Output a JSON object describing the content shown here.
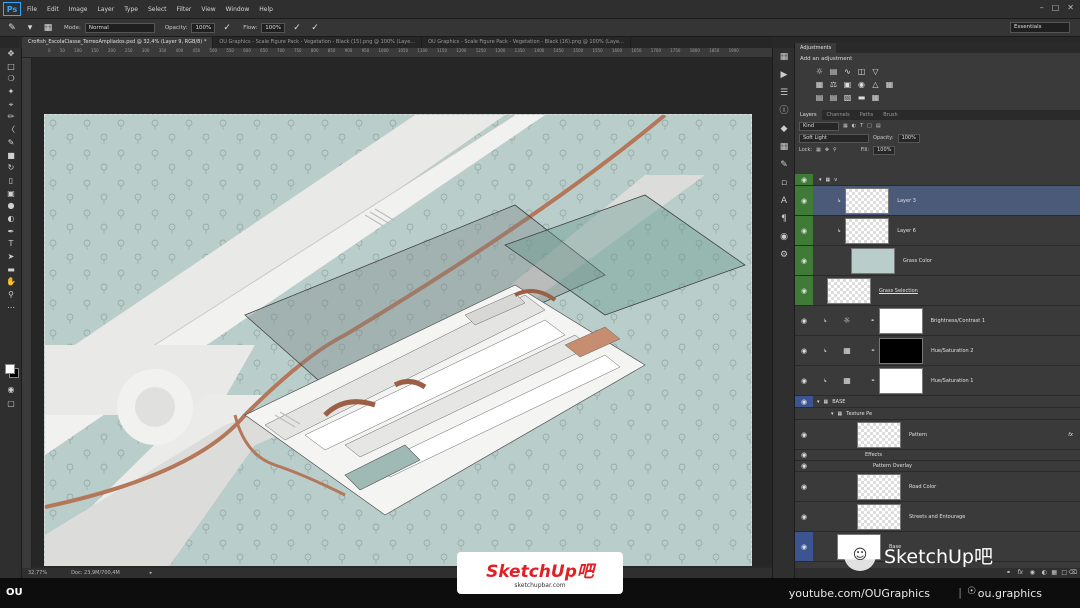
{
  "menubar": {
    "logo": "Ps",
    "items": [
      "File",
      "Edit",
      "Image",
      "Layer",
      "Type",
      "Select",
      "Filter",
      "View",
      "Window",
      "Help"
    ]
  },
  "options": {
    "mode_label": "Mode:",
    "mode_value": "Normal",
    "opacity_label": "Opacity:",
    "opacity_value": "100%",
    "flow_label": "Flow:",
    "flow_value": "100%",
    "workspace": "Essentials"
  },
  "tabs": [
    {
      "label": "Croftsh_EscolaClasse_TerreoAmpliados.psd @ 32,4% (Layer 9, RGB/8) *"
    },
    {
      "label": "OU Graphics - Scale Figure Pack - Vegetation - Black (15).png @ 100% (Laye..."
    },
    {
      "label": "OU Graphics - Scale Figure Pack - Vegetation - Black (16).png @ 100% (Laye..."
    }
  ],
  "ruler": "0 50 100 150 200 250 300 350 400 450 500 550 600 650 700 750 800 850 900 950 1000 1050 1100 1150 1200 1250 1300 1350 1400 1450 1500 1550 1600 1650 1700 1750 1800 1850 1900",
  "status": {
    "zoom": "32,77%",
    "doc": "Doc: 23,9M/700,4M"
  },
  "adjustments": {
    "tab": "Adjustments",
    "title": "Add an adjustment"
  },
  "layers_panel": {
    "tabs": [
      "Layers",
      "Channels",
      "Paths",
      "Brush"
    ],
    "kind": "Kind",
    "blend": "Soft Light",
    "opacity_label": "Opacity:",
    "opacity_value": "100%",
    "lock_label": "Lock:",
    "fill_label": "Fill:",
    "fill_value": "100%",
    "group_v": "v",
    "layers": [
      {
        "name": "Layer 3",
        "thumb": "checker",
        "eye": "green",
        "selected": true
      },
      {
        "name": "Layer 6",
        "thumb": "checker",
        "eye": "green"
      },
      {
        "name": "Grass Color",
        "thumb": "grass",
        "eye": "green"
      },
      {
        "name": "Grass Selection",
        "thumb": "white",
        "eye": "green",
        "underline": true
      },
      {
        "name": "Brightness/Contrast 1",
        "thumb": "white",
        "eye": "none"
      },
      {
        "name": "Hue/Saturation 2",
        "thumb": "black",
        "eye": "none"
      },
      {
        "name": "Hue/Saturation 1",
        "thumb": "white",
        "eye": "none"
      }
    ],
    "group_base": "BASE",
    "group_texture": "Texture Pe",
    "layers2": [
      {
        "name": "Pattern",
        "thumb": "checker"
      },
      {
        "name": "Effects",
        "fx": true
      },
      {
        "name": "Pattern Overlay",
        "fx": true
      },
      {
        "name": "Road Color",
        "thumb": "checker"
      },
      {
        "name": "Streets and Entourage",
        "thumb": "checker"
      },
      {
        "name": "Base",
        "thumb": "white",
        "eye": "blue"
      }
    ]
  },
  "bottom": {
    "logo": "OU",
    "youtube": "youtube.com/OUGraphics",
    "instagram": "ou.graphics"
  },
  "watermarks": {
    "sketchup_main": "SketchUp吧",
    "sketchup_sub": "sketchupbar.com",
    "wechat_text": "SketchUp吧"
  },
  "colors": {
    "accent": "#31a8ff",
    "selected_layer": "#4b5a78",
    "grass": "#b9cdca",
    "road_accent": "#b5775a"
  }
}
